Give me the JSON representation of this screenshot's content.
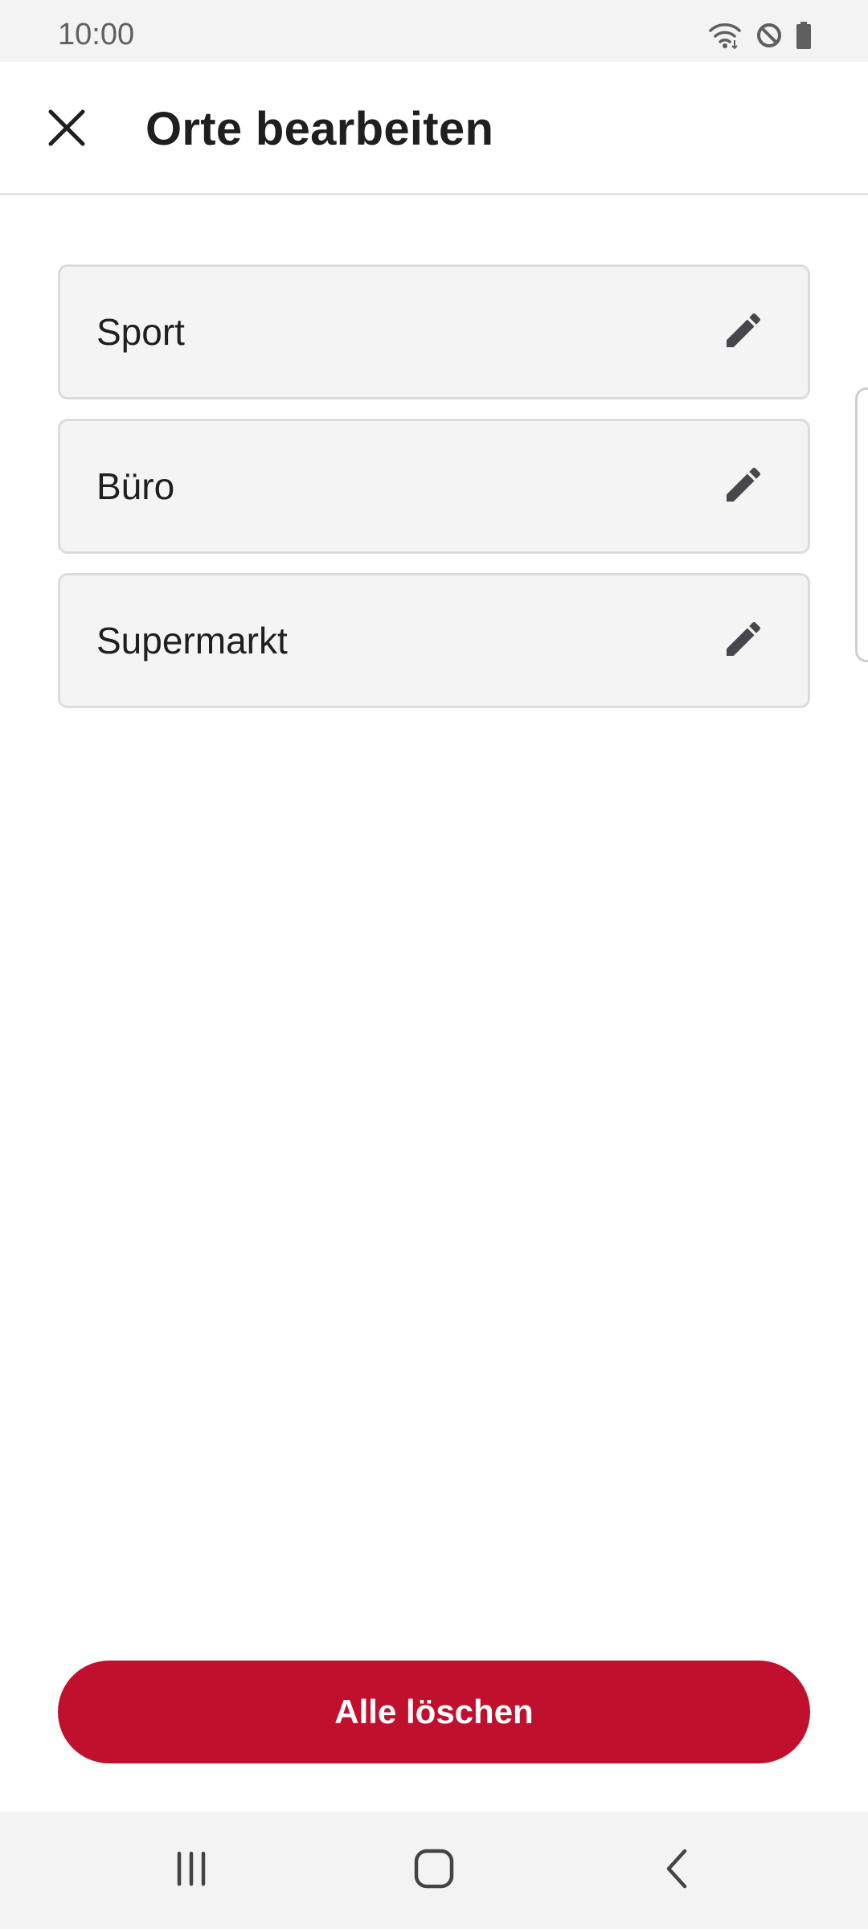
{
  "status_bar": {
    "time": "10:00",
    "icons": [
      "wifi-icon",
      "do-not-disturb-icon",
      "battery-icon"
    ]
  },
  "header": {
    "title": "Orte bearbeiten",
    "close_icon": "close-icon"
  },
  "places": [
    {
      "name": "Sport",
      "edit_icon": "pencil-icon"
    },
    {
      "name": "Büro",
      "edit_icon": "pencil-icon"
    },
    {
      "name": "Supermarkt",
      "edit_icon": "pencil-icon"
    }
  ],
  "footer": {
    "delete_all_label": "Alle löschen"
  },
  "nav_bar": {
    "buttons": [
      "recents-icon",
      "home-icon",
      "back-icon"
    ]
  },
  "colors": {
    "accent": "#c0102d",
    "card_background": "#f4f4f4",
    "card_border": "#dcdcdc",
    "text_primary": "#1f1f1f",
    "icon": "#46464d"
  }
}
